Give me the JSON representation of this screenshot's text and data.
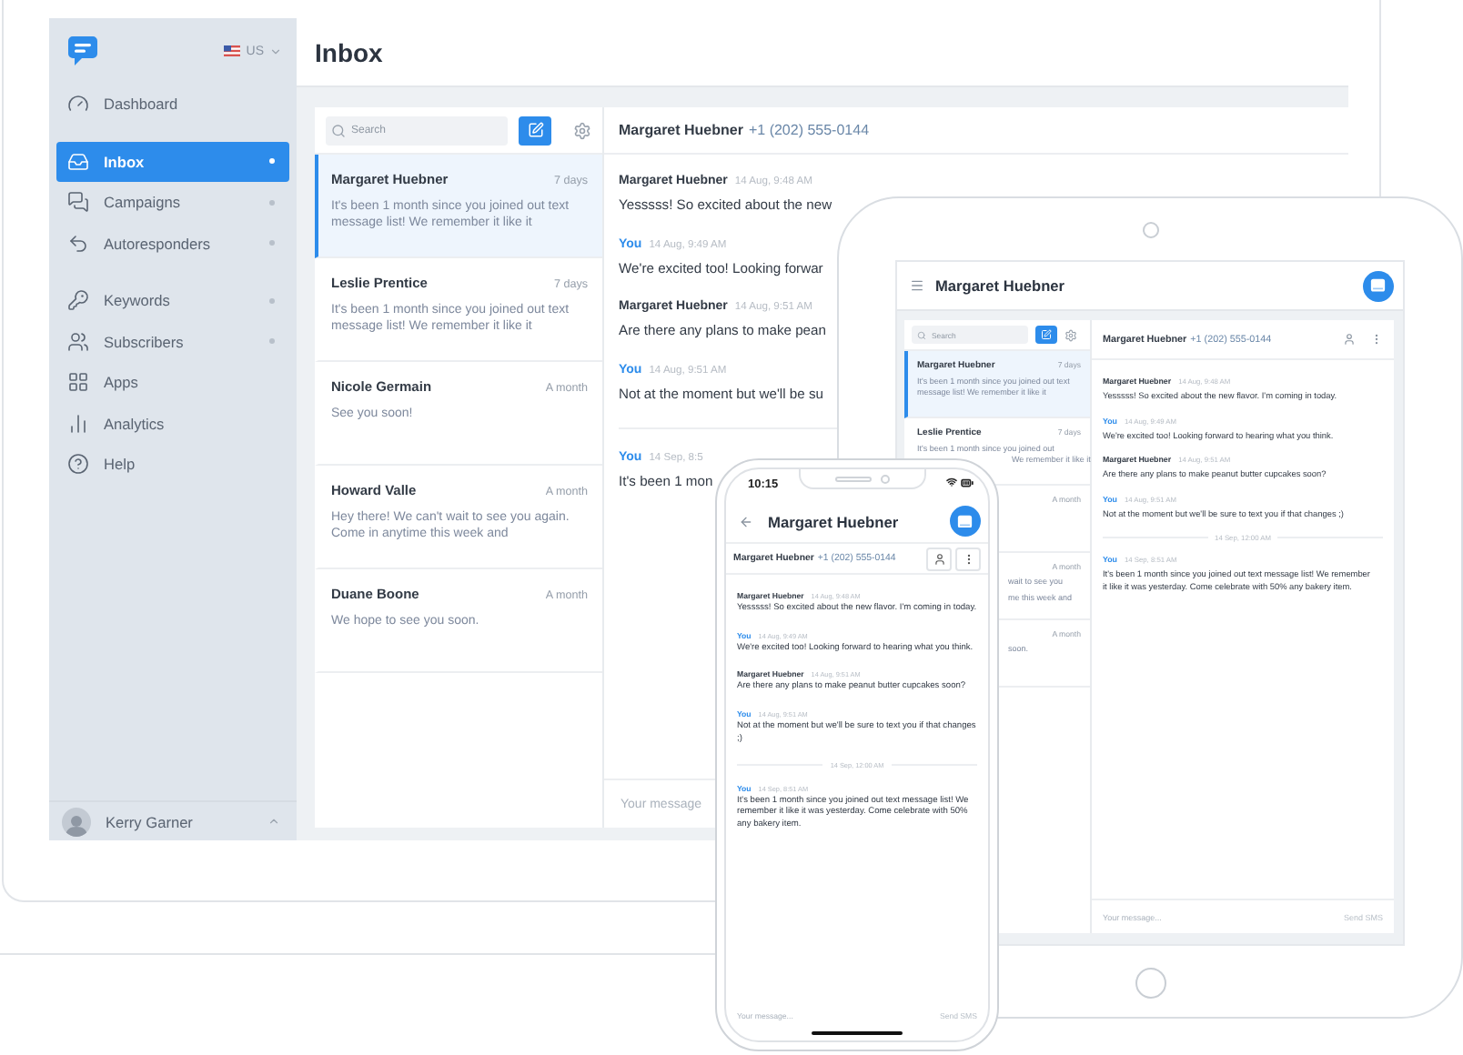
{
  "desktop": {
    "sidebar": {
      "locale": "US",
      "nav_groups": [
        [
          {
            "label": "Dashboard",
            "selected": false,
            "dot": false
          }
        ],
        [
          {
            "label": "Inbox",
            "selected": true,
            "dot": true
          },
          {
            "label": "Campaigns",
            "selected": false,
            "dot": true
          },
          {
            "label": "Autoresponders",
            "selected": false,
            "dot": true
          }
        ],
        [
          {
            "label": "Keywords",
            "selected": false,
            "dot": true
          },
          {
            "label": "Subscribers",
            "selected": false,
            "dot": true
          },
          {
            "label": "Apps",
            "selected": false,
            "dot": false
          },
          {
            "label": "Analytics",
            "selected": false,
            "dot": false
          },
          {
            "label": "Help",
            "selected": false,
            "dot": false
          }
        ]
      ],
      "user": "Kerry Garner"
    },
    "title": "Inbox",
    "search": {
      "placeholder": "Search"
    },
    "conversations": [
      {
        "name": "Margaret Huebner",
        "time": "7 days",
        "preview": "It's been 1 month since you joined out text message list! We remember it like it",
        "selected": true
      },
      {
        "name": "Leslie Prentice",
        "time": "7 days",
        "preview": "It's been 1 month since you joined out text message list! We remember it like it",
        "selected": false
      },
      {
        "name": "Nicole Germain",
        "time": "A month",
        "preview": "See you soon!",
        "selected": false
      },
      {
        "name": "Howard Valle",
        "time": "A month",
        "preview": "Hey there! We can't wait to see you again. Come in anytime this week and",
        "selected": false
      },
      {
        "name": "Duane Boone",
        "time": "A month",
        "preview": "We hope to see you soon.",
        "selected": false
      }
    ],
    "chat": {
      "contact": "Margaret Huebner",
      "phone": "+1 (202) 555-0144",
      "messages": [
        {
          "kind": "message",
          "sender": "Margaret Huebner",
          "self": false,
          "time": "14 Aug, 9:48 AM",
          "text": "Yesssss! So excited about the new"
        },
        {
          "kind": "message",
          "sender": "You",
          "self": true,
          "time": "14 Aug, 9:49 AM",
          "text": "We're excited too! Looking forwar"
        },
        {
          "kind": "message",
          "sender": "Margaret Huebner",
          "self": false,
          "time": "14 Aug, 9:51 AM",
          "text": "Are there any plans to make pean"
        },
        {
          "kind": "message",
          "sender": "You",
          "self": true,
          "time": "14 Aug, 9:51 AM",
          "text": "Not at the moment but we'll be su"
        },
        {
          "kind": "divider"
        },
        {
          "kind": "message",
          "sender": "You",
          "self": true,
          "time": "14 Sep, 8:5",
          "text": "It's been 1 mon"
        }
      ],
      "composer_placeholder": "Your message"
    }
  },
  "tablet": {
    "title": "Margaret Huebner",
    "search": {
      "placeholder": "Search"
    },
    "conversations": [
      {
        "kind": "full",
        "name": "Margaret Huebner",
        "time": "7 days",
        "preview": "It's been 1 month since you joined out text message list! We remember it like it",
        "selected": true
      },
      {
        "kind": "full",
        "name": "Leslie Prentice",
        "time": "7 days",
        "preview": "It's been 1 month since you joined out",
        "tail": [
          "We remember it like it"
        ],
        "selected": false
      },
      {
        "kind": "partial",
        "time": "A month",
        "selected": false
      },
      {
        "kind": "partial",
        "time": "A month",
        "tail": [
          "wait to see you",
          "me this week and"
        ],
        "selected": false
      },
      {
        "kind": "partial",
        "time": "A month",
        "tail": [
          "soon."
        ],
        "selected": false
      }
    ],
    "chat": {
      "contact": "Margaret Huebner",
      "phone": "+1 (202) 555-0144",
      "messages": [
        {
          "kind": "message",
          "sender": "Margaret Huebner",
          "self": false,
          "time": "14 Aug, 9:48 AM",
          "text": "Yesssss! So excited about the new flavor. I'm coming in today."
        },
        {
          "kind": "message",
          "sender": "You",
          "self": true,
          "time": "14 Aug, 9:49 AM",
          "text": "We're excited too! Looking forward to hearing what you think."
        },
        {
          "kind": "message",
          "sender": "Margaret Huebner",
          "self": false,
          "time": "14 Aug, 9:51 AM",
          "text": "Are there any plans to make peanut butter cupcakes soon?"
        },
        {
          "kind": "message",
          "sender": "You",
          "self": true,
          "time": "14 Aug, 9:51 AM",
          "text": "Not at the moment but we'll be sure to text you if that changes ;)"
        },
        {
          "kind": "divider",
          "label": "14 Sep, 12:00 AM"
        },
        {
          "kind": "message",
          "sender": "You",
          "self": true,
          "time": "14 Sep, 8:51 AM",
          "text": "It's been 1 month since you joined out text message list! We remember it like it was yesterday. Come celebrate with 50% any bakery item."
        }
      ],
      "composer_placeholder": "Your message...",
      "send_label": "Send SMS"
    }
  },
  "phone": {
    "clock": "10:15",
    "title": "Margaret Huebner",
    "chat": {
      "contact": "Margaret Huebner",
      "phone": "+1 (202) 555-0144",
      "messages": [
        {
          "kind": "message",
          "sender": "Margaret Huebner",
          "self": false,
          "time": "14 Aug, 9:48 AM",
          "text": "Yesssss! So excited about the new flavor. I'm coming in today."
        },
        {
          "kind": "message",
          "sender": "You",
          "self": true,
          "time": "14 Aug, 9:49 AM",
          "text": "We're excited too! Looking forward to hearing what you think."
        },
        {
          "kind": "message",
          "sender": "Margaret Huebner",
          "self": false,
          "time": "14 Aug, 9:51 AM",
          "text": "Are there any plans to make peanut butter cupcakes soon?"
        },
        {
          "kind": "message",
          "sender": "You",
          "self": true,
          "time": "14 Aug, 9:51 AM",
          "text": "Not at the moment but we'll be sure to text you if that changes ;)"
        },
        {
          "kind": "divider",
          "label": "14 Sep, 12:00 AM"
        },
        {
          "kind": "message",
          "sender": "You",
          "self": true,
          "time": "14 Sep, 8:51 AM",
          "text": "It's been 1 month since you joined out text message list! We remember it like it was yesterday. Come celebrate with 50% any bakery item."
        }
      ],
      "composer_placeholder": "Your message...",
      "send_label": "Send SMS"
    }
  }
}
